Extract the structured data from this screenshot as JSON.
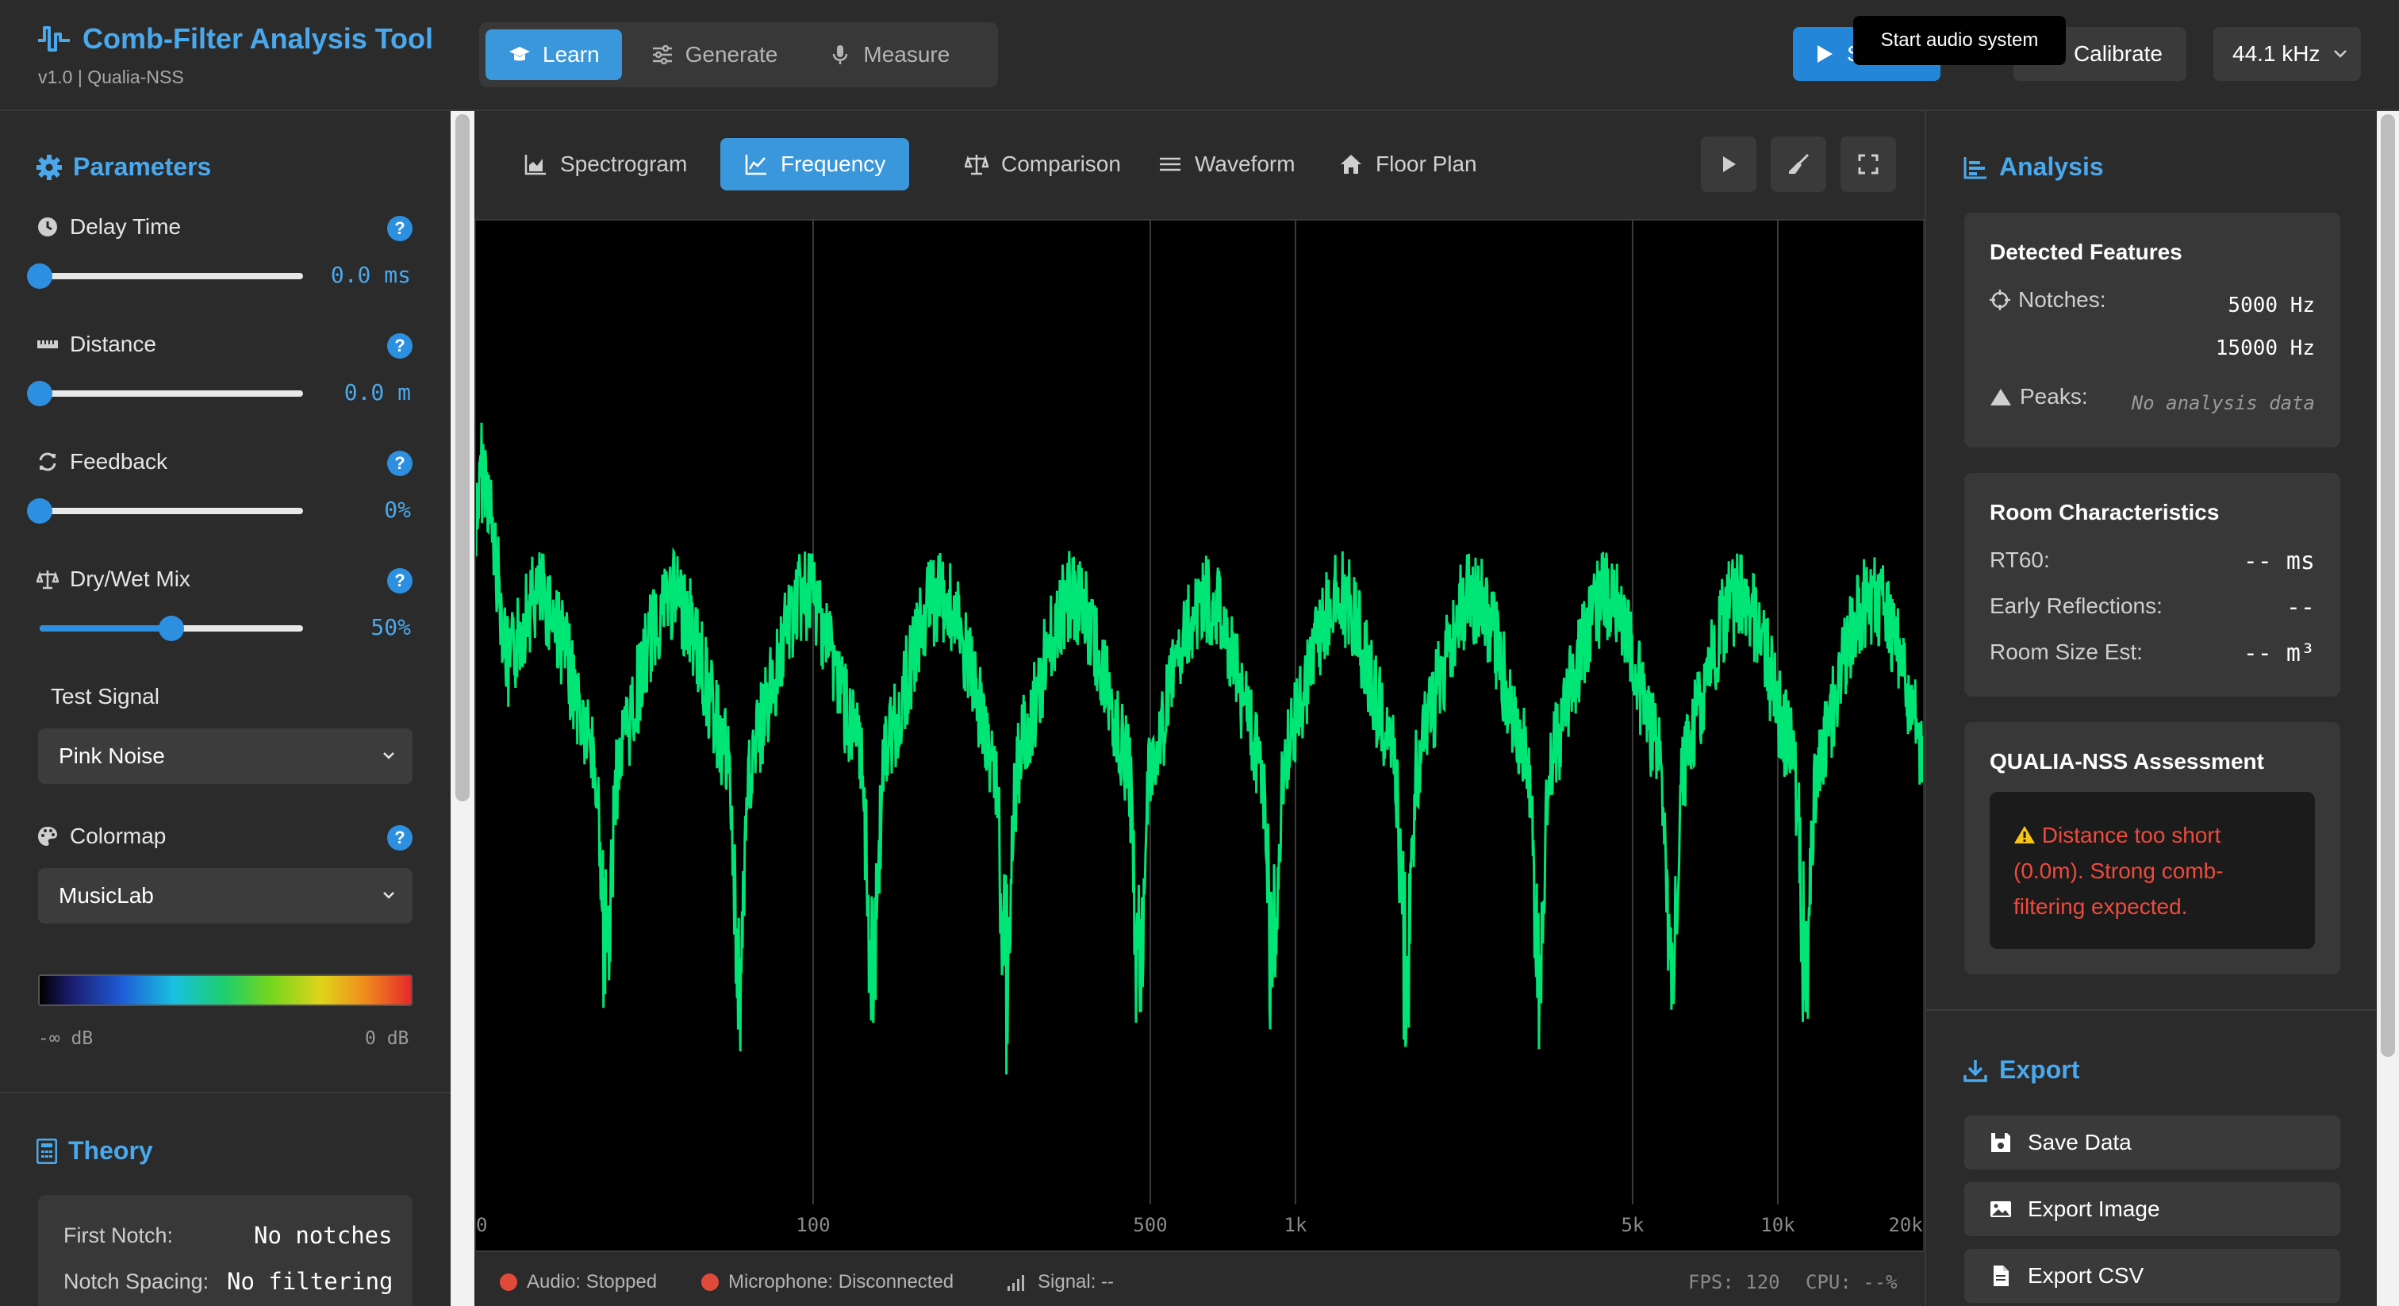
{
  "header": {
    "title": "Comb-Filter Analysis Tool",
    "version": "v1.0 | Qualia-NSS",
    "modes": [
      {
        "label": "Learn",
        "icon": "graduation-cap-icon",
        "active": true
      },
      {
        "label": "Generate",
        "icon": "sliders-icon",
        "active": false
      },
      {
        "label": "Measure",
        "icon": "microphone-icon",
        "active": false
      }
    ],
    "start_label": "S",
    "tooltip": "Start audio system",
    "calibrate_label": "Calibrate",
    "sample_rate": "44.1 kHz"
  },
  "parameters": {
    "title": "Parameters",
    "delay": {
      "label": "Delay Time",
      "value": "0.0 ms",
      "fraction": 0.0
    },
    "distance": {
      "label": "Distance",
      "value": "0.0 m",
      "fraction": 0.0
    },
    "feedback": {
      "label": "Feedback",
      "value": "0%",
      "fraction": 0.0
    },
    "mix": {
      "label": "Dry/Wet Mix",
      "value": "50%",
      "fraction": 0.5
    },
    "help": "?",
    "test_signal": {
      "label": "Test Signal",
      "value": "Pink Noise"
    },
    "colormap": {
      "label": "Colormap",
      "value": "MusicLab",
      "min_label": "-∞ dB",
      "max_label": "0 dB"
    }
  },
  "theory": {
    "title": "Theory",
    "first_notch_label": "First Notch:",
    "first_notch_value": "No notches",
    "notch_spacing_label": "Notch Spacing:",
    "notch_spacing_value": "No filtering"
  },
  "views": {
    "tabs": [
      {
        "label": "Spectrogram",
        "icon": "area-chart-icon",
        "active": false
      },
      {
        "label": "Frequency",
        "icon": "line-chart-icon",
        "active": true
      },
      {
        "label": "Comparison",
        "icon": "balance-scale-icon",
        "active": false
      },
      {
        "label": "Waveform",
        "icon": "waveform-icon",
        "active": false
      },
      {
        "label": "Floor Plan",
        "icon": "home-icon",
        "active": false
      }
    ]
  },
  "chart_data": {
    "type": "line",
    "x_scale": "log",
    "x_ticks": [
      "0",
      "100",
      "500",
      "1k",
      "5k",
      "10k",
      "20k"
    ],
    "line_color": "#00e676",
    "grid": true,
    "shape": "comb-filtered pink noise spectrum with periodic notches"
  },
  "status": {
    "audio": "Audio: Stopped",
    "microphone": "Microphone: Disconnected",
    "signal": "Signal: --",
    "fps": "FPS: 120",
    "cpu": "CPU: --%"
  },
  "analysis": {
    "title": "Analysis",
    "detected": {
      "title": "Detected Features",
      "notches_label": "Notches:",
      "notches": [
        "5000 Hz",
        "15000 Hz"
      ],
      "peaks_label": "Peaks:",
      "peaks_value": "No analysis data"
    },
    "room": {
      "title": "Room Characteristics",
      "rt60_label": "RT60:",
      "rt60_value": "-- ms",
      "early_label": "Early Reflections:",
      "early_value": "--",
      "size_label": "Room Size Est:",
      "size_value": "-- m³"
    },
    "assessment": {
      "title": "QUALIA-NSS Assessment",
      "message": "Distance too short (0.0m). Strong comb-filtering expected."
    }
  },
  "export": {
    "title": "Export",
    "save": "Save Data",
    "image": "Export Image",
    "csv": "Export CSV"
  },
  "colors": {
    "accent": "#3a97dc",
    "signal": "#00e676",
    "warning": "#ef4a3c"
  }
}
